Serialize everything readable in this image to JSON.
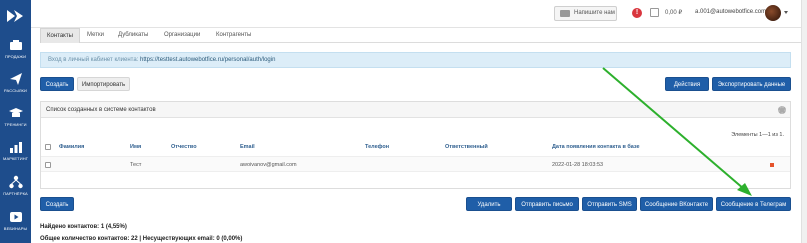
{
  "sidebar": {
    "items": [
      {
        "label": "ПРОДАЖИ",
        "icon": "bar-chart-icon"
      },
      {
        "label": "РАССЫЛКИ",
        "icon": "paper-plane-icon"
      },
      {
        "label": "ТРЕНИНГИ",
        "icon": "graduation-cap-icon"
      },
      {
        "label": "МАРКЕТИНГ",
        "icon": "chart-bars-icon"
      },
      {
        "label": "ПАРТНЁРКА",
        "icon": "people-network-icon"
      },
      {
        "label": "ВЕБИНАРЫ",
        "icon": "play-icon"
      }
    ]
  },
  "topbar": {
    "write_label": "Напишите нам",
    "alert": "!",
    "balance": "0,00 ₽",
    "user_email": "a.001@autowebotfice.com"
  },
  "tabs": [
    "Контакты",
    "Метки",
    "Дубликаты",
    "Организации",
    "Контрагенты"
  ],
  "info": {
    "prefix": "Вход в личный кабинет клиента: ",
    "url": "https://testtest.autowebotfice.ru/personal/auth/login"
  },
  "actions": {
    "create": "Создать",
    "import": "Импортировать",
    "actions": "Действия",
    "export": "Экспортировать данные"
  },
  "panel": {
    "title": "Список созданных в системе контактов",
    "pager": "Элементы 1—1 из 1.",
    "columns": [
      "Фамилия",
      "Имя",
      "Отчество",
      "Email",
      "Телефон",
      "Ответственный",
      "Дата появления контакта в базе"
    ],
    "rows": [
      {
        "last": "",
        "first": "Тест",
        "middle": "",
        "email": "awoivanov@gmail.com",
        "phone": "",
        "owner": "",
        "date": "2022-01-28 18:03:53"
      }
    ]
  },
  "bottom_buttons": {
    "create": "Создать",
    "delete": "Удалить",
    "send_email": "Отправить письмо",
    "send_sms": "Отправить SMS",
    "vk": "Сообщение ВКонтакте",
    "telegram": "Сообщение в Телеграм"
  },
  "stats": {
    "found": "Найдено контактов: 1 (4,55%)",
    "total": "Общее количество контактов: 22 | Несуществующих email: 0 (0,00%)"
  },
  "colors": {
    "sidebar": "#1e4d8c",
    "primary_button": "#1f5ea8",
    "arrow": "#2db02d"
  }
}
